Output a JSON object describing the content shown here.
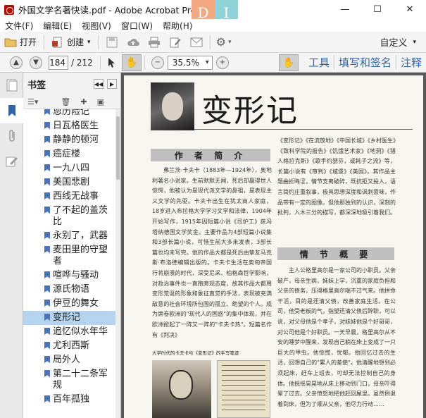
{
  "titlebar": {
    "title": "外国文学名著快读.pdf - Adobe Acrobat Pro",
    "badge": [
      "D",
      "I"
    ],
    "controls": [
      "—",
      "☐",
      "✕"
    ]
  },
  "menu": [
    "文件(F)",
    "编辑(E)",
    "视图(V)",
    "窗口(W)",
    "帮助(H)"
  ],
  "toolbar1": {
    "open_label": "打开",
    "create_label": "创建",
    "custom_label": "自定义"
  },
  "toolbar2": {
    "page_current": "184",
    "page_total": "/ 212",
    "zoom": "35.5%",
    "tools_label": "工具",
    "fill_sign_label": "填写和签名",
    "comment_label": "注释"
  },
  "bookmarks": {
    "title": "书签",
    "items": [
      {
        "label": "恩历险记",
        "selected": false
      },
      {
        "label": "日瓦格医生",
        "selected": false
      },
      {
        "label": "静静的顿河",
        "selected": false
      },
      {
        "label": "癌症楼",
        "selected": false
      },
      {
        "label": "一九八四",
        "selected": false
      },
      {
        "label": "美国悲剧",
        "selected": false
      },
      {
        "label": "西线无战事",
        "selected": false
      },
      {
        "label": "了不起的盖茨比",
        "selected": false
      },
      {
        "label": "永别了，武器",
        "selected": false
      },
      {
        "label": "麦田里的守望者",
        "selected": false
      },
      {
        "label": "喧哗与骚动",
        "selected": false
      },
      {
        "label": "源氏物语",
        "selected": false
      },
      {
        "label": "伊豆的舞女",
        "selected": false
      },
      {
        "label": "变形记",
        "selected": true
      },
      {
        "label": "追忆似水年华",
        "selected": false
      },
      {
        "label": "尤利西斯",
        "selected": false
      },
      {
        "label": "局外人",
        "selected": false
      },
      {
        "label": "第二十二条军规",
        "selected": false
      },
      {
        "label": "百年孤独",
        "selected": false
      }
    ]
  },
  "document": {
    "title": "变形记",
    "section1": "作 者 简 介",
    "section2": "情 节 概 要",
    "col_left": "弗兰茨·卡夫卡（1883年—1924年），奥地利著名小说家。生前默默无闻，死后却赢得世人惊愕，他被认为是现代派文学的鼻祖，是表现主义文学的先驱。卡夫卡出生在犹太商人家庭，18岁进入布拉格大学学习文学和法律，1904年开始写作，1915年因短篇小说《司炉工》获冯塔纳德国文学奖金。主要作品为4部短篇小说集和3部长篇小说，可惜生前大多未发表，3部长篇也均未写完。他的作品大都是死后由挚友马克斯·布洛德编辑出版的。卡夫卡生活在奥匈帝国行将崩溃的时代，深受尼采、柏格森哲学影响，对政治事件也一直抱旁观态度，故其作品大都用变形荒诞的形象和象征直觉的手法，表现被充满敌意的社会环境所包围的孤立、绝望的个人。成为席卷欧洲的\"现代人的困惑\"的集中体现，并在欧洲掀起了一阵又一阵的\"卡夫卡热\"。短篇名作有《判决》",
    "col_right_top": "《变形记》《在流放地》《中国长城》《乡村医生》《致科学院的报告》《饥饿艺术家》《地洞》《猎人格拉克斯》《歌手约瑟芬，或耗子之流》等，长篇小说有《审判》《城堡》《美国》。其作品主题曲折晦涩，情节支离破碎，既抗拒又投入，语言简约庄重叙事，极具思想深度和讽刺意味，作品带有一定的图像。但他那独到的认识，深刻的批判，入木三分的描写，都深深地吸引着我们。",
    "col_right_bottom": "主人公格里高尔是一家公司的小职员。父亲破产，母亲生病，妹妹上学，沉重的家庭负担和父亲的债务，压得格里高尔喘不过气来。他拼命干活，目的是还清父债，改善家庭生活。在公司，他受老板的气，指望还清父债后辞职，可以说，对父母他是个孝子，对妹妹他是个好哥哥，对公司他是个好职员。一天早晨，格里高尔从不安的睡梦中醒来，发现自己躺在床上变成了一只巨大的甲虫。他惊慌，忧郁。他回忆过去的生活，回想自己的\"累人的差使\"。他清醒地想到必须起床，赶车上班去，可却无法控制自己的身体。他摇摇晃晃地从床上移动到门口，母亲吓得晕了过去。父亲愤怒地把他赶回屋里。虽然倒退着到床，但为了顺从父亲，他尽力行动……",
    "caption": "大学时代的卡夫卡与《变形记》的手写笔迹"
  }
}
